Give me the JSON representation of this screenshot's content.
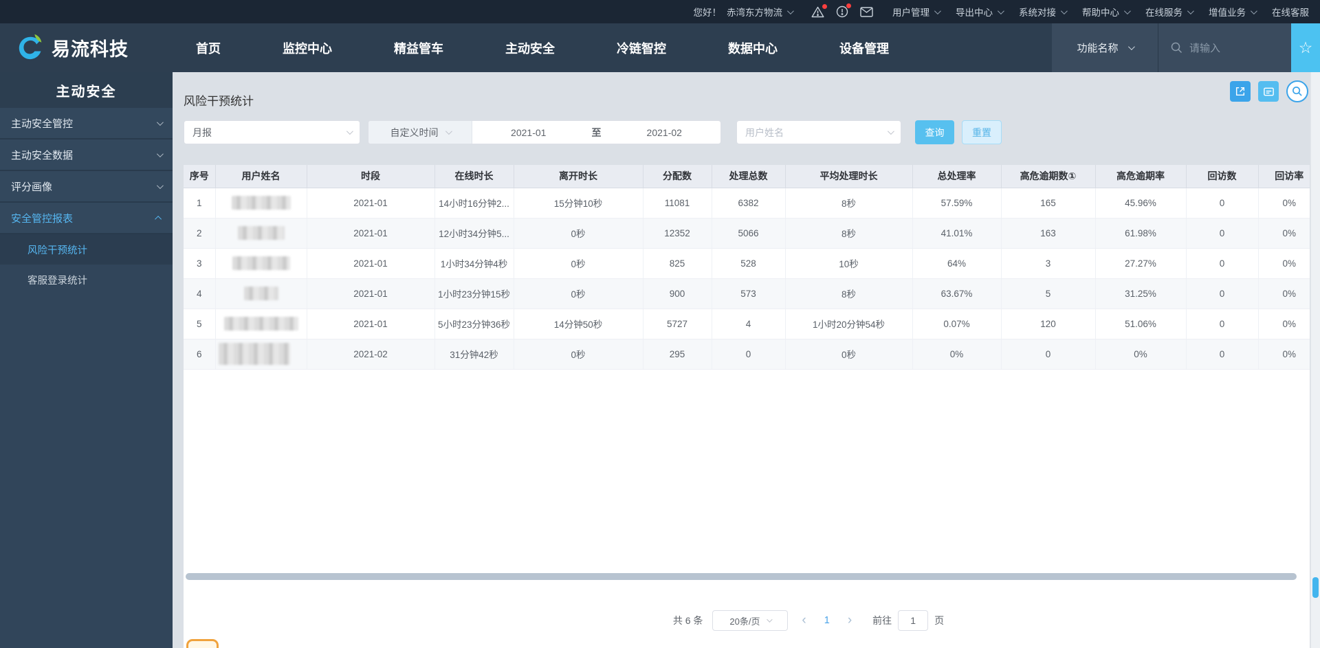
{
  "topbar": {
    "greeting": "您好！",
    "company": "赤湾东方物流",
    "menus": [
      {
        "label": "用户管理",
        "dropdown": true
      },
      {
        "label": "导出中心",
        "dropdown": true
      },
      {
        "label": "系统对接",
        "dropdown": true
      },
      {
        "label": "帮助中心",
        "dropdown": true
      },
      {
        "label": "在线服务",
        "dropdown": true
      },
      {
        "label": "增值业务",
        "dropdown": true
      },
      {
        "label": "在线客服",
        "dropdown": false
      }
    ]
  },
  "navbar": {
    "brand": "易流科技",
    "items": [
      "首页",
      "监控中心",
      "精益管车",
      "主动安全",
      "冷链智控",
      "数据中心",
      "设备管理"
    ],
    "function_select": "功能名称",
    "search_placeholder": "请输入"
  },
  "sidebar": {
    "title": "主动安全",
    "items": [
      {
        "label": "主动安全管控",
        "expanded": false,
        "active": false
      },
      {
        "label": "主动安全数据",
        "expanded": false,
        "active": false
      },
      {
        "label": "评分画像",
        "expanded": false,
        "active": false
      },
      {
        "label": "安全管控报表",
        "expanded": true,
        "active": true
      }
    ],
    "subitems": [
      {
        "label": "风险干预统计",
        "selected": true
      },
      {
        "label": "客服登录统计",
        "selected": false
      }
    ]
  },
  "page": {
    "title": "风险干预统计",
    "filters": {
      "report_type": "月报",
      "time_mode": "自定义时间",
      "date_from": "2021-01",
      "date_separator": "至",
      "date_to": "2021-02",
      "user_placeholder": "用户姓名",
      "query_button": "查询",
      "reset_button": "重置"
    },
    "table": {
      "headers": [
        "序号",
        "用户姓名",
        "时段",
        "在线时长",
        "离开时长",
        "分配数",
        "处理总数",
        "平均处理时长",
        "总处理率",
        "高危逾期数①",
        "高危逾期率",
        "回访数",
        "回访率"
      ],
      "rows": [
        {
          "cells": [
            "1",
            "",
            "2021-01",
            "14小时16分钟2...",
            "15分钟10秒",
            "11081",
            "6382",
            "8秒",
            "57.59%",
            "165",
            "45.96%",
            "0",
            "0%"
          ],
          "blur_w": 86,
          "blur_tall": false
        },
        {
          "cells": [
            "2",
            "",
            "2021-01",
            "12小时34分钟5...",
            "0秒",
            "12352",
            "5066",
            "8秒",
            "41.01%",
            "163",
            "61.98%",
            "0",
            "0%"
          ],
          "blur_w": 68,
          "blur_tall": false
        },
        {
          "cells": [
            "3",
            "",
            "2021-01",
            "1小时34分钟4秒",
            "0秒",
            "825",
            "528",
            "10秒",
            "64%",
            "3",
            "27.27%",
            "0",
            "0%"
          ],
          "blur_w": 84,
          "blur_tall": false
        },
        {
          "cells": [
            "4",
            "",
            "2021-01",
            "1小时23分钟15秒",
            "0秒",
            "900",
            "573",
            "8秒",
            "63.67%",
            "5",
            "31.25%",
            "0",
            "0%"
          ],
          "blur_w": 50,
          "blur_tall": false
        },
        {
          "cells": [
            "5",
            "",
            "2021-01",
            "5小时23分钟36秒",
            "14分钟50秒",
            "5727",
            "4",
            "1小时20分钟54秒",
            "0.07%",
            "120",
            "51.06%",
            "0",
            "0%"
          ],
          "blur_w": 108,
          "blur_tall": false
        },
        {
          "cells": [
            "6",
            "",
            "2021-02",
            "31分钟42秒",
            "0秒",
            "295",
            "0",
            "0秒",
            "0%",
            "0",
            "0%",
            "0",
            "0%"
          ],
          "blur_w": 104,
          "blur_tall": true
        }
      ]
    },
    "pagination": {
      "total": "共 6 条",
      "page_size": "20条/页",
      "current_page": "1",
      "goto_label": "前往",
      "goto_value": "1",
      "page_unit": "页"
    }
  },
  "colors": {
    "topbar_bg": "#1b2634",
    "navbar_bg": "#2d3e50",
    "sidebar_bg": "#31455a",
    "accent_blue": "#4cc2f1",
    "primary_button": "#57c0ef",
    "sidebar_active": "#56b6f0",
    "badge_red": "#fb3f3f",
    "table_header_bg": "#e9ecf2"
  }
}
